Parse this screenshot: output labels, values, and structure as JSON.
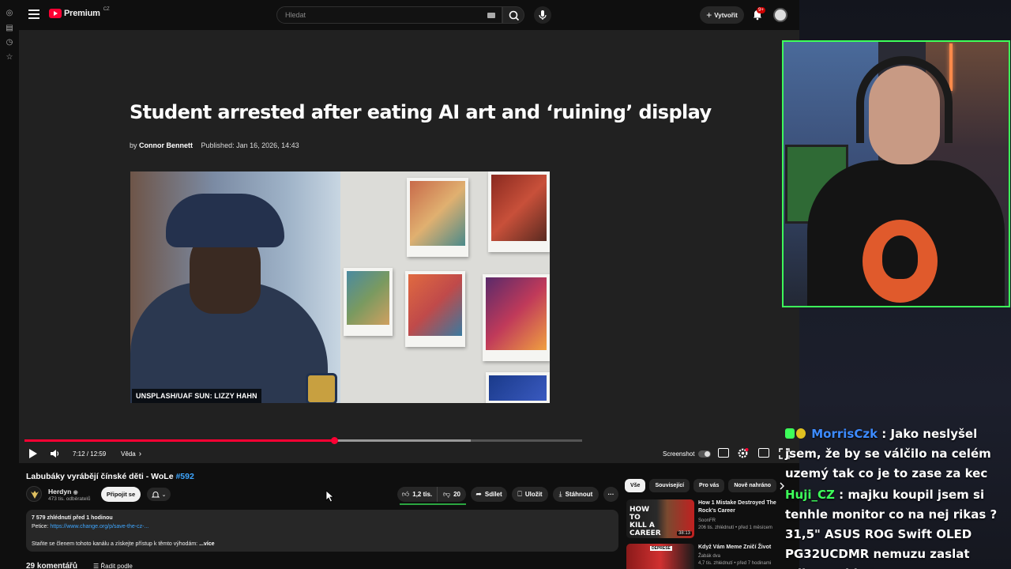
{
  "topbar": {
    "logo_text": "Premium",
    "logo_region": "CZ",
    "search_placeholder": "Hledat",
    "create_label": "Vytvořit",
    "notifications_badge": "9+"
  },
  "player": {
    "headline": "Student arrested after eating AI art and ‘ruining’ display",
    "byline_prefix": "by",
    "author": "Connor Bennett",
    "published": "Published: Jan 16, 2026, 14:43",
    "photo_credit": "UNSPLASH/UAF SUN: LIZZY HAHN",
    "time": "7:12 / 12:59",
    "chapter": "Věda",
    "chapter_arrow": "›",
    "screenshot_label": "Screenshot",
    "played_fraction": 0.555,
    "buffered_fraction": 0.8
  },
  "video": {
    "title": "Labubáky vyrábějí čínské děti - WoLe",
    "title_tag": "#592",
    "channel_name": "Herdyn",
    "subscribers": "473 tis. odběratelů",
    "join_label": "Připojit se",
    "likes": "1,2 tis.",
    "dislikes": "20",
    "share_label": "Sdílet",
    "save_label": "Uložit",
    "download_label": "Stáhnout",
    "more_label": "···",
    "views_time": "7 579 zhlédnutí  před 1 hodinou",
    "petition_label": "Petice:",
    "petition_link": "https://www.change.org/p/save-the-cz-...",
    "desc_line2": "Staňte se členem tohoto kanálu a získejte přístup k těmto výhodám:",
    "desc_more": "...více",
    "comments_count": "29 komentářů",
    "sort_label": "Řadit podle"
  },
  "related": {
    "chips": [
      "Vše",
      "Související",
      "Pro vás",
      "Nově nahráno"
    ],
    "items": [
      {
        "thumb_text": "HOW TO KILL A CAREER",
        "duration": "38:13",
        "title": "How 1 Mistake Destroyed The Rock's Career",
        "channel": "SoonFR",
        "meta": "206 tis. zhlédnutí • před 1 měsícem"
      },
      {
        "thumb_text": "DEPRESE",
        "title": "Když Vám Meme Zničí Život",
        "channel": "Žabák dva",
        "meta": "4,7 tis. zhlédnutí • před 7 hodinami"
      }
    ]
  },
  "chat": {
    "messages": [
      {
        "user": "MorrisCzk",
        "text": ": Jako neslyšel jsem, že by se válčilo na celém uzemý tak co je to zase za kec"
      },
      {
        "user": "Huji_CZ",
        "text": ": majku koupil jsem si tenhle monitor co na nej rikas ? 31,5\" ASUS ROG Swift OLED PG32UCDMR nemuzu zaslat odkaz nejde to"
      }
    ]
  },
  "colors": {
    "brand_red": "#ff0033",
    "link_blue": "#3ea6ff",
    "webcam_border": "#3dff5a",
    "chat_user1": "#3d8bff",
    "chat_user2": "#3dff5a"
  }
}
